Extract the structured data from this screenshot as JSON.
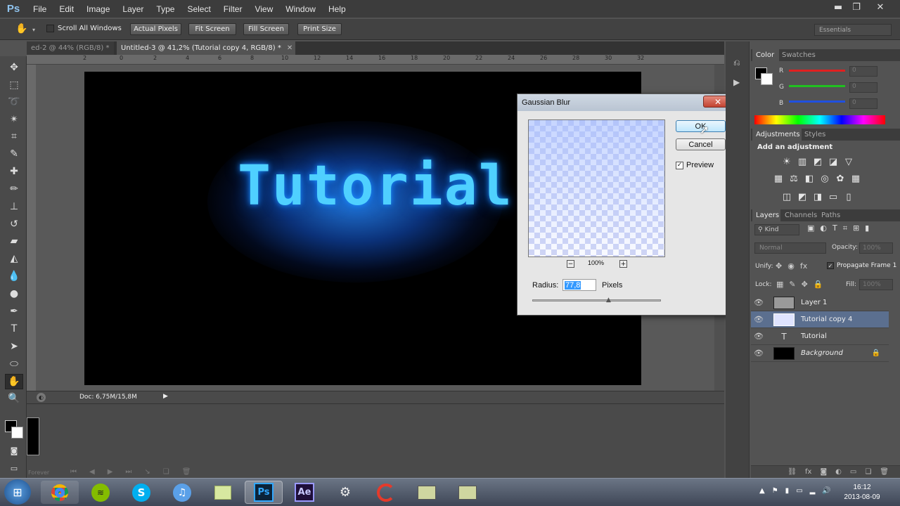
{
  "app": {
    "logo": "Ps"
  },
  "menu": [
    "File",
    "Edit",
    "Image",
    "Layer",
    "Type",
    "Select",
    "Filter",
    "View",
    "Window",
    "Help"
  ],
  "window_controls": {
    "minimize": "▬",
    "restore": "❐",
    "close": "✕"
  },
  "options_bar": {
    "scroll_all_label": "Scroll All Windows",
    "buttons": [
      "Actual Pixels",
      "Fit Screen",
      "Fill Screen",
      "Print Size"
    ],
    "workspace": "Essentials"
  },
  "tabs": [
    {
      "label": "ed-2 @ 44% (RGB/8) *",
      "active": false
    },
    {
      "label": "Untitled-3 @ 41,2% (Tutorial copy 4, RGB/8) *",
      "active": true
    }
  ],
  "ruler": {
    "h_ticks": [
      "2",
      "0",
      "2",
      "4",
      "6",
      "8",
      "10",
      "12",
      "14",
      "16",
      "18",
      "20",
      "22",
      "24",
      "26",
      "28",
      "30",
      "32"
    ]
  },
  "canvas": {
    "text": "Tutorial"
  },
  "status": {
    "doc": "Doc: 6,75M/15,8M"
  },
  "timeline": {
    "forever_label": "Forever"
  },
  "dialog": {
    "title": "Gaussian Blur",
    "ok_label": "OK",
    "cancel_label": "Cancel",
    "preview_label": "Preview",
    "preview_checked": true,
    "zoom": "100%",
    "radius_label": "Radius:",
    "radius_value": "77,8",
    "radius_unit": "Pixels"
  },
  "color_panel": {
    "tabs": [
      "Color",
      "Swatches"
    ],
    "channels": [
      {
        "label": "R",
        "value": "0",
        "color": "#e02020"
      },
      {
        "label": "G",
        "value": "0",
        "color": "#20c020"
      },
      {
        "label": "B",
        "value": "0",
        "color": "#2050e0"
      }
    ]
  },
  "adjustments_panel": {
    "tabs": [
      "Adjustments",
      "Styles"
    ],
    "heading": "Add an adjustment"
  },
  "layers_panel": {
    "tabs": [
      "Layers",
      "Channels",
      "Paths"
    ],
    "kind_label": "Kind",
    "blend_mode": "Normal",
    "opacity_label": "Opacity:",
    "opacity_value": "100%",
    "unify_label": "Unify:",
    "propagate_label": "Propagate Frame 1",
    "lock_label": "Lock:",
    "fill_label": "Fill:",
    "fill_value": "100%",
    "layers": [
      {
        "name": "Layer 1",
        "selected": false
      },
      {
        "name": "Tutorial copy 4",
        "selected": true
      },
      {
        "name": "Tutorial",
        "selected": false,
        "type_layer": "T"
      },
      {
        "name": "Background",
        "selected": false,
        "locked": true
      }
    ]
  },
  "taskbar": {
    "time": "16:12",
    "date": "2013-08-09",
    "apps": [
      "chrome",
      "spotify",
      "skype",
      "itunes",
      "notes",
      "photoshop",
      "after-effects",
      "network",
      "ccleaner",
      "monitor-1",
      "monitor-2"
    ],
    "ps_label": "Ps",
    "ae_label": "Ae"
  },
  "colors": {
    "accent": "#4fd0ff",
    "selection": "#5b6f8f"
  }
}
